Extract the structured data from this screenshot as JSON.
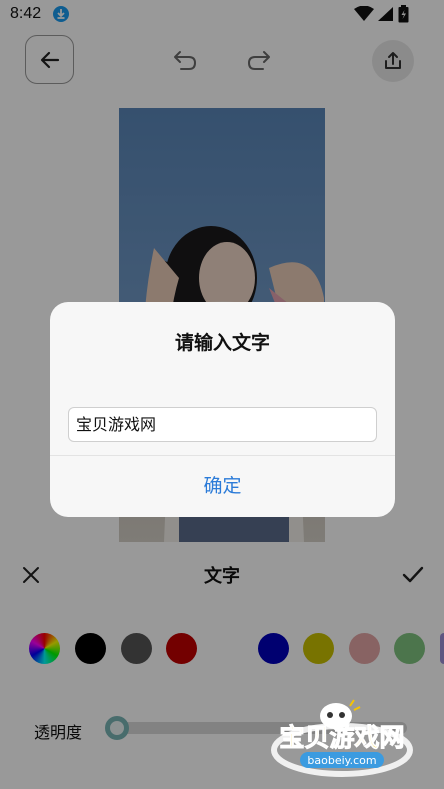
{
  "status_bar": {
    "time": "8:42"
  },
  "toolbar": {
    "back_icon": "arrow-left-icon",
    "undo_icon": "undo-icon",
    "redo_icon": "redo-icon",
    "share_icon": "share-icon"
  },
  "photo": {
    "description_icon": "photo-canvas"
  },
  "dialog": {
    "title": "请输入文字",
    "input_value": "宝贝游戏网",
    "ok_label": "确定",
    "ok_color": "#2b7bd8"
  },
  "panel": {
    "title": "文字",
    "close_icon": "close-icon",
    "confirm_icon": "check-icon",
    "colors": [
      "rainbow",
      "#000000",
      "#555555",
      "#c00000",
      "#ffffff",
      "#0000bb",
      "#c8c000",
      "#e3a6a6",
      "#7fc47f",
      "#9d8fd8"
    ],
    "opacity_label": "透明度",
    "opacity_value": 0.0
  },
  "watermark": {
    "brand": "宝贝游戏网",
    "url": "baobeiy.com"
  }
}
